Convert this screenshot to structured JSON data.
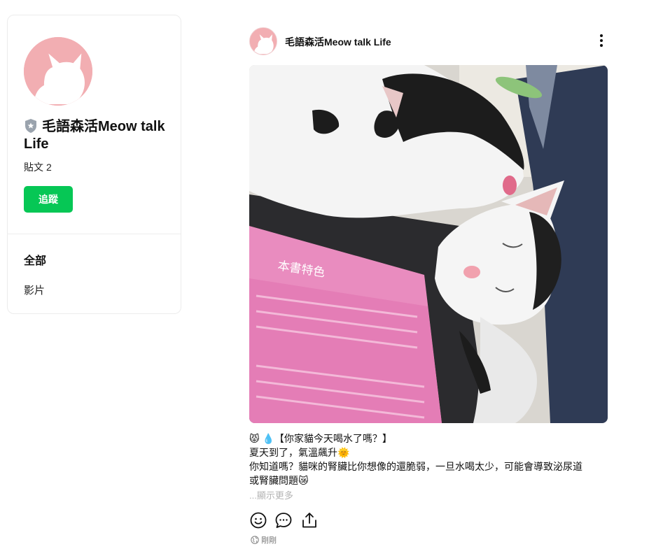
{
  "profile": {
    "name": "毛語森活Meow talk Life",
    "posts_label": "貼文",
    "posts_count": "2",
    "follow_label": "追蹤",
    "tabs": [
      {
        "label": "全部"
      },
      {
        "label": "影片"
      }
    ]
  },
  "post": {
    "author": "毛語森活Meow talk Life",
    "lines": [
      "😾 💧【你家貓今天喝水了嗎？】",
      "夏天到了，氣溫飆升🌞",
      "你知道嗎？貓咪的腎臟比你想像的還脆弱，一旦水喝太少，可能會導致泌尿道",
      "或腎臟問題😿"
    ],
    "show_more": "...顯示更多",
    "timestamp": "剛剛",
    "photo_text": {
      "book_heading": "本書特色"
    }
  },
  "colors": {
    "brand_pink": "#f2aeb2",
    "follow_green": "#06c755",
    "muted_text": "#b3b3b3"
  },
  "icons": {
    "badge": "shield-star-icon",
    "more": "vertical-dots-icon",
    "like": "smiley-icon",
    "comment": "speech-bubble-icon",
    "share": "share-icon",
    "privacy": "globe-icon"
  }
}
